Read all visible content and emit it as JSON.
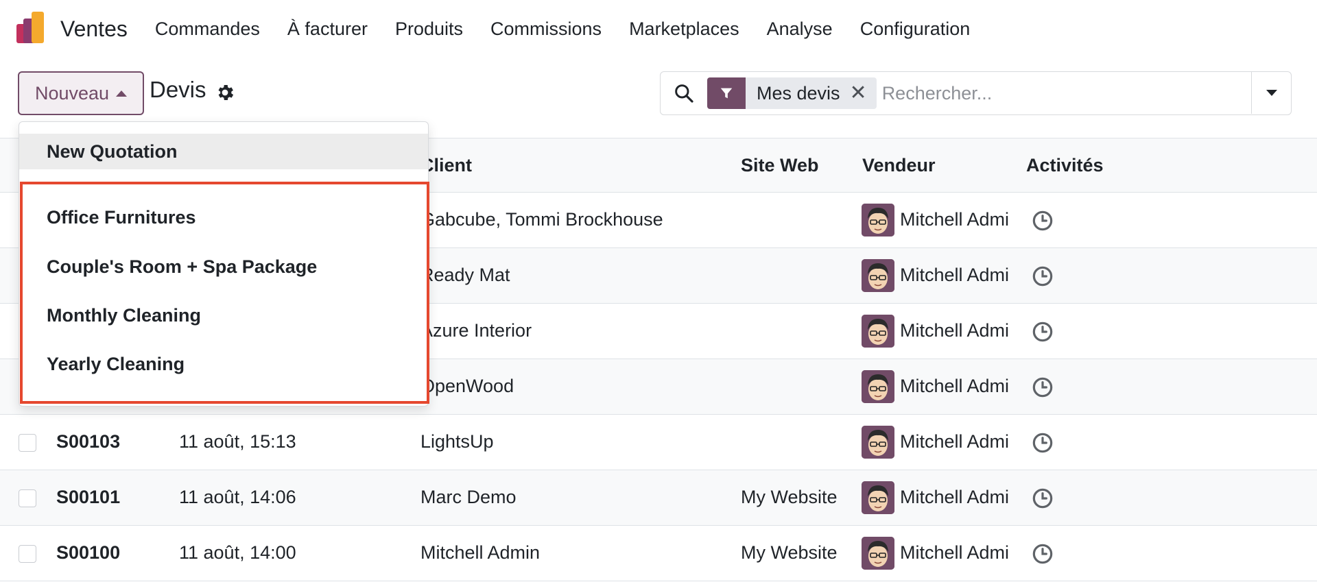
{
  "app": {
    "name": "Ventes"
  },
  "nav": [
    "Commandes",
    "À facturer",
    "Produits",
    "Commissions",
    "Marketplaces",
    "Analyse",
    "Configuration"
  ],
  "control": {
    "new_label": "Nouveau",
    "title": "Devis"
  },
  "search": {
    "facet_label": "Mes devis",
    "placeholder": "Rechercher..."
  },
  "table": {
    "headers": {
      "client": "Client",
      "website": "Site Web",
      "vendor": "Vendeur",
      "activities": "Activités"
    },
    "rows": [
      {
        "number": "",
        "date": "",
        "client": "Gabcube, Tommi Brockhouse",
        "website": "",
        "vendor": "Mitchell Admi"
      },
      {
        "number": "",
        "date": "",
        "client": "Ready Mat",
        "website": "",
        "vendor": "Mitchell Admi"
      },
      {
        "number": "",
        "date": "",
        "client": "Azure Interior",
        "website": "",
        "vendor": "Mitchell Admi"
      },
      {
        "number": "",
        "date": "",
        "client": "OpenWood",
        "website": "",
        "vendor": "Mitchell Admi"
      },
      {
        "number": "S00103",
        "date": "11 août, 15:13",
        "client": "LightsUp",
        "website": "",
        "vendor": "Mitchell Admi"
      },
      {
        "number": "S00101",
        "date": "11 août, 14:06",
        "client": "Marc Demo",
        "website": "My Website",
        "vendor": "Mitchell Admi"
      },
      {
        "number": "S00100",
        "date": "11 août, 14:00",
        "client": "Mitchell Admin",
        "website": "My Website",
        "vendor": "Mitchell Admi"
      }
    ]
  },
  "dropdown": {
    "first": "New Quotation",
    "templates": [
      "Office Furnitures",
      "Couple's Room + Spa Package",
      "Monthly Cleaning",
      "Yearly Cleaning"
    ]
  },
  "colors": {
    "brand": "#714b67",
    "highlight": "#e5482f"
  }
}
